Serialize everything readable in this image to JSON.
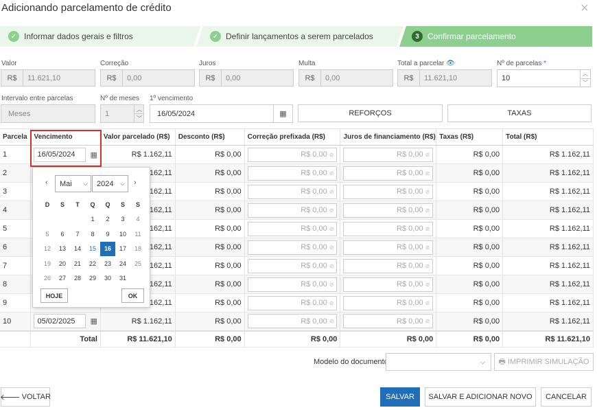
{
  "dialog": {
    "title": "Adicionando parcelamento de crédito",
    "close": "×"
  },
  "steps": [
    {
      "label": "Informar dados gerais e filtros",
      "icon": "✓"
    },
    {
      "label": "Definir lançamentos a serem parcelados",
      "icon": "✓"
    },
    {
      "label": "Confirmar parcelamento",
      "icon": "3"
    }
  ],
  "colors": {
    "step_done": "#e9f6e9",
    "step_active": "#8ccf8e",
    "primary": "#1f6fb8",
    "highlight": "#d32f2f"
  },
  "form": {
    "valor": {
      "label": "Valor",
      "prefix": "R$",
      "value": "11.621,10"
    },
    "correcao": {
      "label": "Correção",
      "prefix": "R$",
      "value": "0,00"
    },
    "juros": {
      "label": "Juros",
      "prefix": "R$",
      "value": "0,00"
    },
    "multa": {
      "label": "Multa",
      "prefix": "R$",
      "value": "0,00"
    },
    "total": {
      "label": "Total a parcelar",
      "prefix": "R$",
      "value": "11.621,10",
      "icon": "eye-icon"
    },
    "parcelas": {
      "label": "Nº de parcelas",
      "required": "*",
      "value": "10"
    },
    "intervalo": {
      "label": "Intervalo entre parcelas",
      "value": "Meses"
    },
    "meses": {
      "label": "Nº de meses",
      "value": "1"
    },
    "vencimento": {
      "label": "1º vencimento",
      "value": "16/05/2024"
    },
    "reforcos": "REFORÇOS",
    "taxas": "TAXAS"
  },
  "table": {
    "headers": [
      "Parcela",
      "Vencimento",
      "Valor parcelado (R$)",
      "Desconto (R$)",
      "Correção prefixada (R$)",
      "Juros de financiamento (R$)",
      "Taxas (R$)",
      "Total (R$)"
    ],
    "rows": [
      {
        "n": "1",
        "venc": "16/05/2024",
        "valor": "R$ 1.162,11",
        "desc": "R$ 0,00",
        "corr": "R$ 0,00",
        "juros": "R$ 0,00",
        "taxas": "R$ 0,00",
        "total": "R$ 1.162,11"
      },
      {
        "n": "2",
        "venc": "",
        "valor": "1.162,11",
        "desc": "R$ 0,00",
        "corr": "R$ 0,00",
        "juros": "R$ 0,00",
        "taxas": "R$ 0,00",
        "total": "R$ 1.162,11"
      },
      {
        "n": "3",
        "venc": "",
        "valor": "1.162,11",
        "desc": "R$ 0,00",
        "corr": "R$ 0,00",
        "juros": "R$ 0,00",
        "taxas": "R$ 0,00",
        "total": "R$ 1.162,11"
      },
      {
        "n": "4",
        "venc": "",
        "valor": "1.162,11",
        "desc": "R$ 0,00",
        "corr": "R$ 0,00",
        "juros": "R$ 0,00",
        "taxas": "R$ 0,00",
        "total": "R$ 1.162,11"
      },
      {
        "n": "5",
        "venc": "",
        "valor": "1.162,11",
        "desc": "R$ 0,00",
        "corr": "R$ 0,00",
        "juros": "R$ 0,00",
        "taxas": "R$ 0,00",
        "total": "R$ 1.162,11"
      },
      {
        "n": "6",
        "venc": "",
        "valor": "1.162,11",
        "desc": "R$ 0,00",
        "corr": "R$ 0,00",
        "juros": "R$ 0,00",
        "taxas": "R$ 0,00",
        "total": "R$ 1.162,11"
      },
      {
        "n": "7",
        "venc": "",
        "valor": "1.162,11",
        "desc": "R$ 0,00",
        "corr": "R$ 0,00",
        "juros": "R$ 0,00",
        "taxas": "R$ 0,00",
        "total": "R$ 1.162,11"
      },
      {
        "n": "8",
        "venc": "",
        "valor": "1.162,11",
        "desc": "R$ 0,00",
        "corr": "R$ 0,00",
        "juros": "R$ 0,00",
        "taxas": "R$ 0,00",
        "total": "R$ 1.162,11"
      },
      {
        "n": "9",
        "venc": "",
        "valor": "1.162,11",
        "desc": "R$ 0,00",
        "corr": "R$ 0,00",
        "juros": "R$ 0,00",
        "taxas": "R$ 0,00",
        "total": "R$ 1.162,11"
      },
      {
        "n": "10",
        "venc": "05/02/2025",
        "valor": "R$ 1.162,11",
        "desc": "R$ 0,00",
        "corr": "R$ 0,00",
        "juros": "R$ 0,00",
        "taxas": "R$ 0,00",
        "total": "R$ 1.162,11"
      }
    ],
    "totals": {
      "label": "Total",
      "valor": "R$ 11.621,10",
      "desc": "R$ 0,00",
      "corr": "R$ 0,00",
      "juros": "R$ 0,00",
      "taxas": "R$ 0,00",
      "total": "R$ 11.621,10"
    }
  },
  "datepicker": {
    "prev": "‹",
    "next": "›",
    "month": "Mai",
    "year": "2024",
    "weekdays": [
      "D",
      "S",
      "T",
      "Q",
      "Q",
      "S",
      "S"
    ],
    "days": [
      "",
      "",
      "",
      "1",
      "2",
      "3",
      "4",
      "5",
      "6",
      "7",
      "8",
      "9",
      "10",
      "11",
      "12",
      "13",
      "14",
      "15",
      "16",
      "17",
      "18",
      "19",
      "20",
      "21",
      "22",
      "23",
      "24",
      "25",
      "26",
      "27",
      "28",
      "29",
      "30",
      "31"
    ],
    "selected": "16",
    "today_label": "HOJE",
    "ok_label": "OK"
  },
  "footer": {
    "modelo_label": "Modelo do documento",
    "imprimir": "IMPRIMIR SIMULAÇÃO",
    "voltar": "VOLTAR",
    "salvar": "SALVAR",
    "salvar_novo": "SALVAR E ADICIONAR NOVO",
    "cancelar": "CANCELAR"
  }
}
